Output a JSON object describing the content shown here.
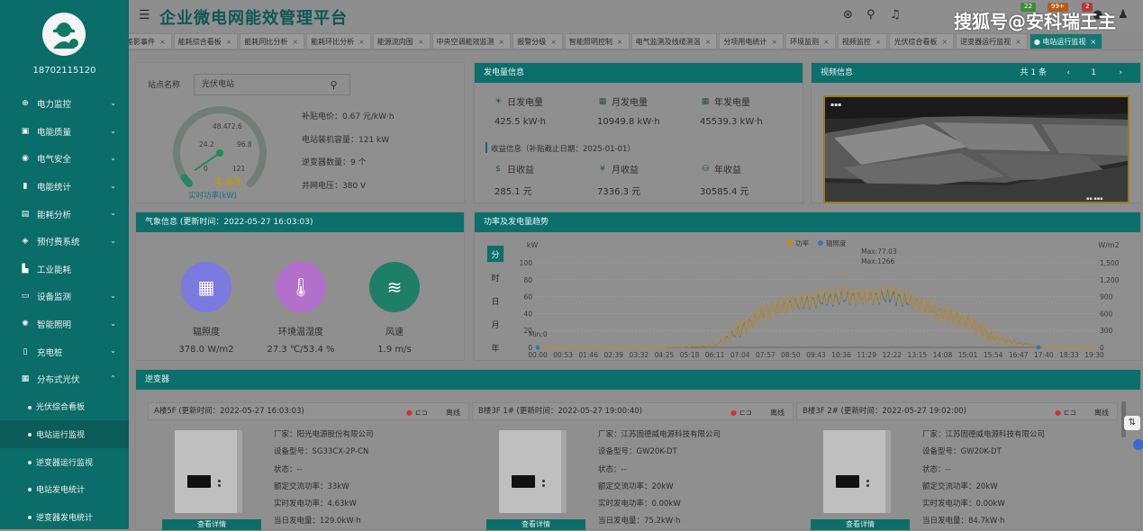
{
  "sidebar": {
    "phone": "18702115120",
    "items": [
      {
        "label": "电力监控",
        "icon": "lightning-icon"
      },
      {
        "label": "电能质量",
        "icon": "quality-icon"
      },
      {
        "label": "电气安全",
        "icon": "safety-icon"
      },
      {
        "label": "电能统计",
        "icon": "bar-chart-icon"
      },
      {
        "label": "能耗分析",
        "icon": "analysis-icon"
      },
      {
        "label": "预付费系统",
        "icon": "prepaid-icon"
      },
      {
        "label": "工业能耗",
        "icon": "factory-icon"
      },
      {
        "label": "设备监测",
        "icon": "monitor-icon"
      },
      {
        "label": "智能照明",
        "icon": "bulb-icon"
      },
      {
        "label": "充电桩",
        "icon": "charger-icon"
      },
      {
        "label": "分布式光伏",
        "icon": "grid-icon"
      }
    ],
    "subitems": [
      "光伏综合看板",
      "电站运行监视",
      "逆变器运行监视",
      "电站发电统计",
      "逆变器发电统计"
    ]
  },
  "header": {
    "title": "企业微电网能效管理平台",
    "watermark": "搜狐号@安科瑞王主",
    "badges": [
      "22",
      "99+",
      "2"
    ],
    "badge_colors": [
      "#3d8a3c",
      "#b45c1c",
      "#b33b33"
    ]
  },
  "tabs": [
    "差影事件",
    "能耗综合看板",
    "能耗同比分析",
    "能耗环比分析",
    "能源流向图",
    "中央空调能效监测",
    "报警分级",
    "智能照明控制",
    "电气监测及线缆测温",
    "分项用电统计",
    "环境监测",
    "视频监控",
    "光伏综合看板",
    "逆变器运行监视",
    "电站运行监视"
  ],
  "station": {
    "label": "站点名称",
    "value": "光伏电站",
    "info": [
      "补贴电价：0.67 元/kW·h",
      "电站装机容量：121 kW",
      "逆变器数量：9 个",
      "并网电压：380 V"
    ],
    "gauge": {
      "value": "4.63",
      "caption": "实时功率(kW)",
      "ticks": [
        "0",
        "24.2",
        "48.4",
        "72.6",
        "96.8",
        "121"
      ],
      "min": 0,
      "max": 121,
      "reading": 4.63
    }
  },
  "generation": {
    "title": "发电量信息",
    "items": [
      {
        "label": "日发电量",
        "value": "425.5 kW·h"
      },
      {
        "label": "月发电量",
        "value": "10949.8 kW·h"
      },
      {
        "label": "年发电量",
        "value": "45539.3 kW·h"
      }
    ],
    "income_title": "收益信息（补贴截止日期：2025-01-01）",
    "income": [
      {
        "label": "日收益",
        "value": "285.1 元"
      },
      {
        "label": "月收益",
        "value": "7336.3 元"
      },
      {
        "label": "年收益",
        "value": "30585.4 元"
      }
    ]
  },
  "video": {
    "title": "视频信息",
    "pager": "共 1 条",
    "page": "1",
    "prev": "‹",
    "next": "›"
  },
  "weather": {
    "title": "气象信息 (更新时间：2022-05-27 16:03:03)",
    "items": [
      {
        "label": "辐照度",
        "value": "378.0 W/m2",
        "color": "#7a7ae0"
      },
      {
        "label": "环境温湿度",
        "value": "27.3 ℃/53.4 %",
        "color": "#b36fcc"
      },
      {
        "label": "风速",
        "value": "1.9 m/s",
        "color": "#1f7f66"
      }
    ]
  },
  "trend": {
    "title": "功率及发电量趋势",
    "radios": [
      "分",
      "时",
      "日",
      "月",
      "年"
    ],
    "legend": [
      "功率",
      "辐照度"
    ],
    "unit_left": "kW",
    "unit_right": "W/m2",
    "max_label": "Max:77.03",
    "max2_label": "Max:1266",
    "min_label": "Min:0",
    "colors": [
      "#c68a1a",
      "#2f79b8"
    ]
  },
  "chart_data": {
    "type": "line",
    "x": [
      "00:00",
      "00:53",
      "01:46",
      "02:39",
      "03:32",
      "04:25",
      "05:18",
      "06:11",
      "07:04",
      "07:57",
      "08:50",
      "09:43",
      "10:36",
      "11:29",
      "12:22",
      "13:15",
      "14:08",
      "15:01",
      "15:54",
      "16:47",
      "17:40",
      "18:33",
      "19:30"
    ],
    "ylim_left": [
      0,
      100
    ],
    "ylim_right": [
      0,
      1500
    ],
    "yticks_left": [
      "0",
      "20",
      "40",
      "60",
      "80",
      "100"
    ],
    "yticks_right": [
      "0",
      "300",
      "600",
      "900",
      "1,200",
      "1,500"
    ],
    "series": [
      {
        "name": "功率",
        "values": [
          0,
          0,
          0,
          0,
          0,
          0,
          1,
          3,
          22,
          42,
          52,
          58,
          62,
          60,
          65,
          52,
          40,
          30,
          12,
          4,
          0,
          0,
          0
        ]
      },
      {
        "name": "辐照度",
        "values": [
          0,
          0,
          0,
          0,
          0,
          0,
          10,
          40,
          300,
          640,
          760,
          830,
          880,
          890,
          900,
          780,
          600,
          450,
          180,
          70,
          0,
          0,
          0
        ]
      }
    ]
  },
  "inverter": {
    "title": "逆变器",
    "view_label": "查看详情",
    "offline": "离线",
    "cards": [
      {
        "title": "A楼5F (更新时间：2022-05-27 16:03:03)",
        "lines": [
          "厂家：阳光电源股份有限公司",
          "设备型号：SG33CX-2P-CN",
          "状态：--",
          "额定交流功率：33kW",
          "实时发电功率：4.63kW",
          "当日发电量：129.0kW·h"
        ]
      },
      {
        "title": "B楼3F 1# (更新时间：2022-05-27 19:00:40)",
        "lines": [
          "厂家：江苏固德威电源科技有限公司",
          "设备型号：GW20K-DT",
          "状态：--",
          "额定交流功率：20kW",
          "实时发电功率：0.00kW",
          "当日发电量：75.2kW·h"
        ]
      },
      {
        "title": "B楼3F 2# (更新时间：2022-05-27 19:02:00)",
        "lines": [
          "厂家：江苏固德威电源科技有限公司",
          "设备型号：GW20K-DT",
          "状态：--",
          "额定交流功率：20kW",
          "实时发电功率：0.00kW",
          "当日发电量：84.7kW·h"
        ]
      }
    ]
  }
}
